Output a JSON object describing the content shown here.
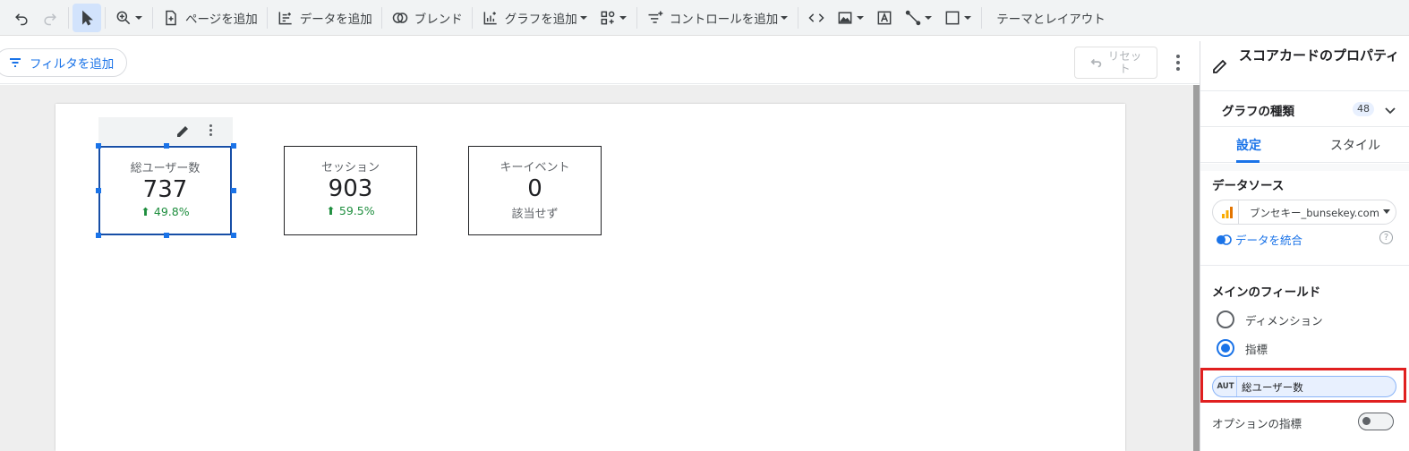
{
  "toolbar": {
    "add_page": "ページを追加",
    "add_data": "データを追加",
    "blend": "ブレンド",
    "add_chart": "グラフを追加",
    "add_control": "コントロールを追加",
    "theme_layout": "テーマとレイアウト"
  },
  "filterbar": {
    "add_filter": "フィルタを追加",
    "reset_line1": "リセッ",
    "reset_line2": "ト"
  },
  "scorecards": [
    {
      "label": "総ユーザー数",
      "value": "737",
      "delta": "49.8%"
    },
    {
      "label": "セッション",
      "value": "903",
      "delta": "59.5%"
    },
    {
      "label": "キーイベント",
      "value": "0",
      "delta": "該当せず"
    }
  ],
  "panel": {
    "title": "スコアカードのプロパティ",
    "chart_type_label": "グラフの種類",
    "chart_type_badge": "48",
    "tab_setup": "設定",
    "tab_style": "スタイル",
    "data_source_title": "データソース",
    "data_source_value": "ブンセキー_bunsekey.com",
    "blend_data": "データを統合",
    "help": "?",
    "main_field_title": "メインのフィールド",
    "dimension": "ディメンション",
    "metric": "指標",
    "metric_chip_type": "AUT",
    "metric_chip_value": "総ユーザー数",
    "optional_metrics": "オプションの指標"
  },
  "colors": {
    "accent": "#1a73e8",
    "positive": "#1e8e3e",
    "highlight": "#e01f1f"
  }
}
